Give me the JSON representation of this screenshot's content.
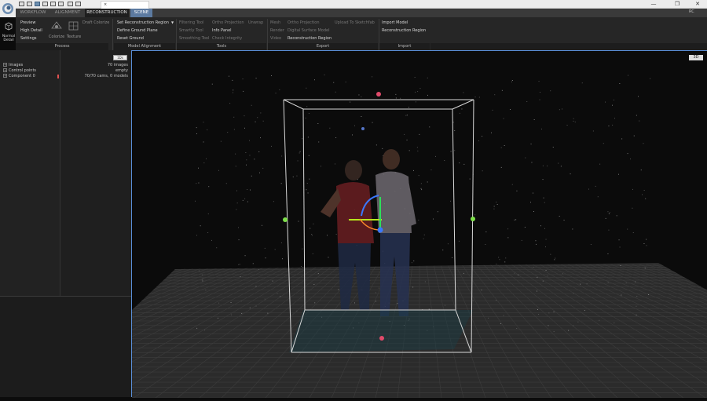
{
  "title_bar": {
    "tab_label": "×",
    "window_buttons": [
      "—",
      "❐",
      "✕"
    ]
  },
  "ribbon": {
    "tabs": [
      {
        "label": "WORKFLOW"
      },
      {
        "label": "ALIGNMENT"
      },
      {
        "label": "RECONSTRUCTION"
      },
      {
        "label": "SCENE"
      }
    ],
    "user_initials": "RC",
    "process": {
      "normal_detail": "Normal Detail",
      "preview": "Preview",
      "high_detail": "High Detail",
      "settings": "Settings",
      "colorize": "Colorize",
      "texture": "Texture",
      "draft_colorize": "Draft Colorize",
      "group_label": "Process"
    },
    "model_alignment": {
      "set_reconstruction_region": "Set Reconstruction Region",
      "define_ground_plane": "Define Ground Plane",
      "reset_ground": "Reset Ground",
      "group_label": "Model Alignment"
    },
    "tools": {
      "filtering_tool": "Filtering Tool",
      "smartly_tool": "Smartly Tool",
      "smoothing_tool": "Smoothing Tool",
      "ortho_projection": "Ortho Projection",
      "unwrap": "Unwrap",
      "info_panel": "Info Panel",
      "check_integrity": "Check Integrity",
      "group_label": "Tools"
    },
    "export": {
      "mesh": "Mesh",
      "render": "Render",
      "video": "Video",
      "ortho_projection": "Ortho Projection",
      "digital_surface_model": "Digital Surface Model",
      "reconstruction_region": "Reconstruction Region",
      "upload_sketchfab": "Upload To Sketchfab",
      "group_label": "Export"
    },
    "import": {
      "import_model": "Import Model",
      "reconstruction_region": "Reconstruction Region",
      "group_label": "Import"
    }
  },
  "left_panel": {
    "search_label": "1Ds",
    "tree": [
      {
        "label": "Images",
        "value": "70 images"
      },
      {
        "label": "Control points",
        "value": "empty"
      },
      {
        "label": "Component 0",
        "value": "70/70 cams, 0 models"
      }
    ]
  },
  "viewport": {
    "view_badge": "3D",
    "accent_color": "#5a8fd8"
  }
}
